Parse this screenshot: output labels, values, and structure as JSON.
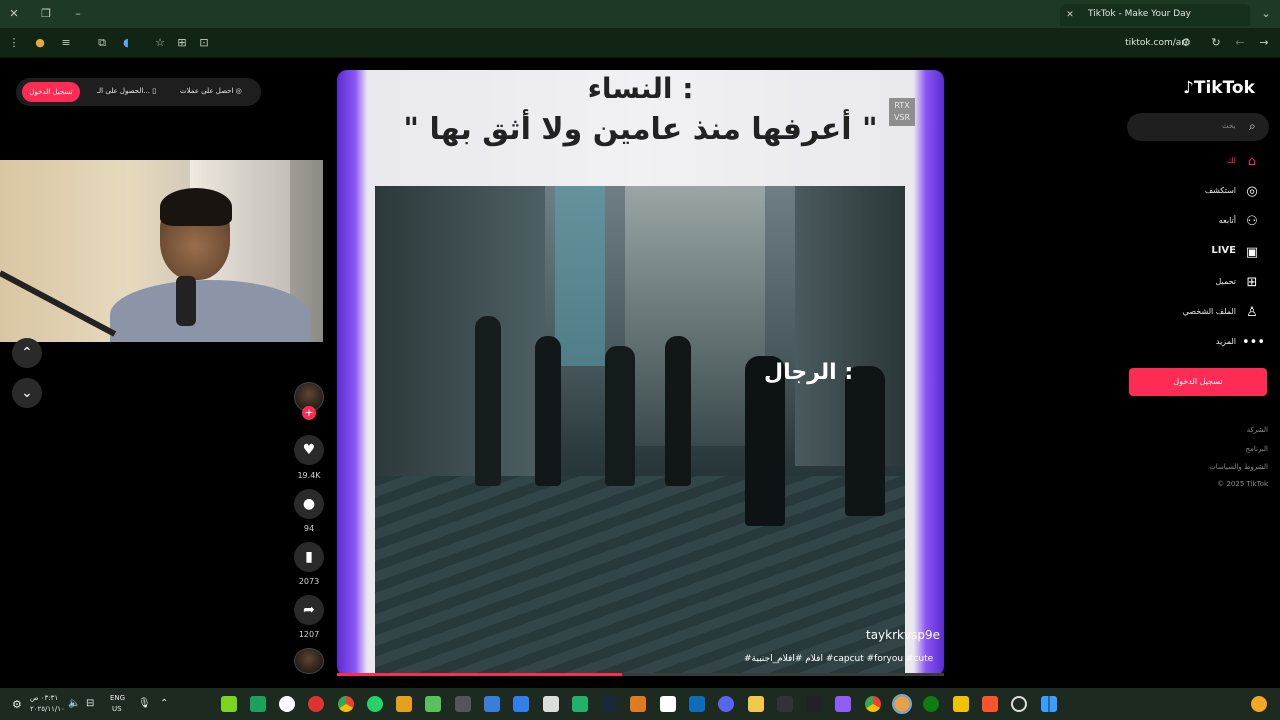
{
  "browser": {
    "tab_title": "TikTok - Make Your Day",
    "url": "tiktok.com/ar/"
  },
  "topbar": {
    "login_label": "تسجيل الدخول",
    "get_app_label": "الحصول على الـ...",
    "get_coins_label": "احصل على عملات"
  },
  "video": {
    "caption_line1": "النساء :",
    "caption_line2": "\" أعرفها منذ عامين ولا أثق بها \"",
    "overlay_label": "الرجال :",
    "watermark": "RTX\nVSR",
    "author_handle": "taykrkvsp9e",
    "hashtags": "#افلام #افلام_اجنبية #capcut #foryou #cute",
    "progress_fraction": 0.47
  },
  "actions": {
    "likes": "19.4K",
    "comments": "94",
    "saves": "2073",
    "shares": "1207"
  },
  "sidebar": {
    "logo": "TikTok",
    "search_placeholder": "بحث",
    "items": [
      {
        "label": "لك",
        "icon": "home-icon",
        "active": true
      },
      {
        "label": "استكشف",
        "icon": "compass-icon"
      },
      {
        "label": "أتابعه",
        "icon": "following-icon"
      },
      {
        "label": "LIVE",
        "icon": "live-icon"
      },
      {
        "label": "تحميل",
        "icon": "upload-icon"
      },
      {
        "label": "الملف الشخصي",
        "icon": "profile-icon"
      },
      {
        "label": "المزيد",
        "icon": "more-icon"
      }
    ],
    "login_label": "تسجيل الدخول",
    "footer": [
      "الشركة",
      "البرنامج",
      "الشروط والسياسات",
      "© 2025 TikTok"
    ]
  },
  "taskbar": {
    "time": "٠٣:٣١ ص",
    "date": "٢٠٢٥/١١/١٠",
    "lang": "ENG",
    "region": "US"
  },
  "colors": {
    "accent": "#fe2c55",
    "chrome_green": "#1e3a24"
  }
}
